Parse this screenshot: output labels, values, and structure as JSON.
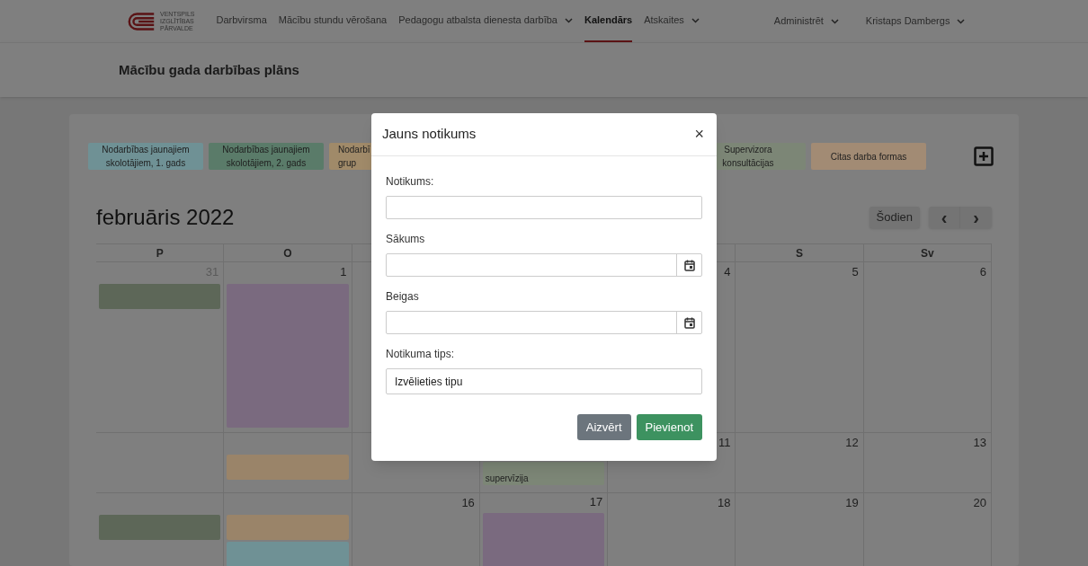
{
  "nav": {
    "logo_lines": [
      "VENTSPILS",
      "IZGLĪTĪBAS",
      "PĀRVALDE"
    ],
    "links": [
      {
        "label": "Darbvirsma",
        "dropdown": false,
        "selected": false
      },
      {
        "label": "Mācību stundu vērošana",
        "dropdown": false,
        "selected": false
      },
      {
        "label": "Pedagogu atbalsta dienesta darbība",
        "dropdown": true,
        "selected": false
      },
      {
        "label": "Kalendārs",
        "dropdown": false,
        "selected": true
      },
      {
        "label": "Atskaites",
        "dropdown": true,
        "selected": false
      }
    ],
    "right": [
      {
        "label": "Administrēt",
        "dropdown": true
      },
      {
        "label": "Kristaps Dambergs",
        "dropdown": true
      }
    ]
  },
  "page_title": "Mācību gada darbības plāns",
  "legend": [
    {
      "lines": [
        "Nodarbības jaunajiem",
        "skolotājiem, 1. gads"
      ],
      "color": "#6f9195"
    },
    {
      "lines": [
        "Nodarbības jaunajiem",
        "skolotājiem, 2. gads"
      ],
      "color": "#5a7b69"
    },
    {
      "lines": [
        "Nodarbī",
        "grup"
      ],
      "color": "#a08a69"
    },
    {
      "lines": [
        "Supervizora",
        "konsultācijas"
      ],
      "color": "#7c8676"
    },
    {
      "lines": [
        "Citas darba formas"
      ],
      "color": "#a28b74"
    }
  ],
  "calendar": {
    "title": "februāris 2022",
    "today_button": "Šodien",
    "prev": "‹",
    "next": "›",
    "weekdays": {
      "mon": "P",
      "tue": "O",
      "sat": "S",
      "sun": "Sv"
    },
    "weeks": [
      {
        "mon": {
          "day": "31",
          "muted": true,
          "events": [
            {
              "color": "#5d6758",
              "kind": "short"
            }
          ]
        },
        "tue": {
          "day": "1",
          "muted": false,
          "events": [
            {
              "color": "#7a6a7f",
              "kind": "tall"
            }
          ]
        },
        "fri": {
          "day": "4",
          "muted": false
        },
        "sat": {
          "day": "5",
          "muted": false
        },
        "sun": {
          "day": "6",
          "muted": false
        }
      },
      {
        "tue": {
          "events": [
            {
              "color": "#9a8469",
              "kind": "short"
            }
          ]
        },
        "thu": {
          "events": [
            {
              "color": "#7c8676",
              "kind": "labeled",
              "label": "supervīzija"
            }
          ]
        },
        "fri": {
          "day": "11",
          "muted": false
        },
        "sat": {
          "day": "12",
          "muted": false
        },
        "sun": {
          "day": "13",
          "muted": false
        }
      },
      {
        "mon": {
          "events": [
            {
              "color": "#5d6758",
              "kind": "short"
            }
          ]
        },
        "tue": {
          "events": [
            {
              "color": "#9a8469",
              "kind": "short"
            },
            {
              "color": "#6f9195",
              "kind": "short"
            }
          ]
        },
        "wed": {
          "day": "16",
          "muted": false
        },
        "thu": {
          "day": "17",
          "muted": false,
          "events": [
            {
              "color": "#7a6a7f",
              "kind": "tall"
            }
          ]
        },
        "fri": {
          "day": "18",
          "muted": false
        },
        "sat": {
          "day": "19",
          "muted": false
        },
        "sun": {
          "day": "20",
          "muted": false
        }
      }
    ]
  },
  "modal": {
    "title": "Jauns notikums",
    "close": "×",
    "fields": [
      {
        "kind": "text",
        "label": "Notikums:"
      },
      {
        "kind": "date",
        "label": "Sākums"
      },
      {
        "kind": "date",
        "label": "Beigas"
      },
      {
        "kind": "select",
        "label": "Notikuma tips:",
        "value": "Izvēlieties tipu"
      }
    ],
    "buttons": [
      {
        "label": "Aizvērt",
        "kind": "secondary"
      },
      {
        "label": "Pievienot",
        "kind": "primary"
      }
    ]
  }
}
